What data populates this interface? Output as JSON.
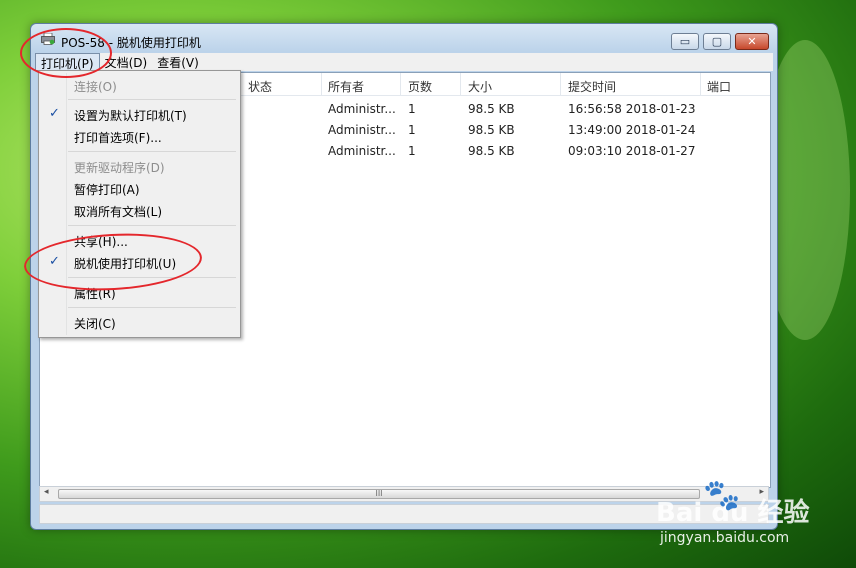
{
  "window": {
    "title": "POS-58  -  脱机使用打印机",
    "controls": {
      "minimize": "▭",
      "maximize": "▢",
      "close": "✕"
    }
  },
  "menubar": {
    "items": [
      {
        "label": "打印机(P)",
        "active": true
      },
      {
        "label": "文档(D)",
        "active": false
      },
      {
        "label": "查看(V)",
        "active": false
      }
    ]
  },
  "list": {
    "columns": [
      "状态",
      "所有者",
      "页数",
      "大小",
      "提交时间",
      "端口"
    ],
    "rows": [
      {
        "status": "",
        "owner": "Administr...",
        "pages": "1",
        "size": "98.5 KB",
        "submitted": "16:56:58  2018-01-23",
        "port": ""
      },
      {
        "status": "",
        "owner": "Administr...",
        "pages": "1",
        "size": "98.5 KB",
        "submitted": "13:49:00  2018-01-24",
        "port": ""
      },
      {
        "status": "",
        "owner": "Administr...",
        "pages": "1",
        "size": "98.5 KB",
        "submitted": "09:03:10  2018-01-27",
        "port": ""
      }
    ]
  },
  "scrollbar": {
    "left": "◂",
    "right": "▸",
    "grip": "III"
  },
  "dropdown": {
    "items": [
      {
        "label": "连接(O)",
        "disabled": true,
        "checked": false
      },
      {
        "label": "设置为默认打印机(T)",
        "disabled": false,
        "checked": true
      },
      {
        "label": "打印首选项(F)...",
        "disabled": false,
        "checked": false
      },
      {
        "label": "更新驱动程序(D)",
        "disabled": true,
        "checked": false
      },
      {
        "label": "暂停打印(A)",
        "disabled": false,
        "checked": false
      },
      {
        "label": "取消所有文档(L)",
        "disabled": false,
        "checked": false
      },
      {
        "label": "共享(H)...",
        "disabled": false,
        "checked": false
      },
      {
        "label": "脱机使用打印机(U)",
        "disabled": false,
        "checked": true
      },
      {
        "label": "属性(R)",
        "disabled": false,
        "checked": false
      },
      {
        "label": "关闭(C)",
        "disabled": false,
        "checked": false
      }
    ],
    "check_glyph": "✓"
  },
  "watermark": {
    "logo": "Bai  du 经验",
    "paw": "🐾",
    "url": "jingyan.baidu.com"
  },
  "colors": {
    "annotation_red": "#e4272c",
    "check_blue": "#1a4fa3"
  }
}
